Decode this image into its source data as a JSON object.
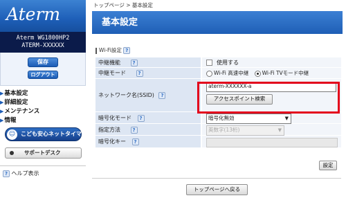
{
  "sidebar": {
    "brand": "Aterm",
    "model_line1": "Aterm WG1800HP2",
    "model_line2": "ATERM-XXXXXX",
    "save_label": "保存",
    "logout_label": "ログアウト",
    "nav": [
      {
        "label": "基本設定"
      },
      {
        "label": "詳細設定"
      },
      {
        "label": "メンテナンス"
      },
      {
        "label": "情報"
      }
    ],
    "kids_timer_label": "こども安心ネットタイマー",
    "support_label": "サポートデスク",
    "help_label": "ヘルプ表示"
  },
  "breadcrumb": "トップページ > 基本設定",
  "page_title": "基本設定",
  "section_label": "Wi-Fi設定",
  "form": {
    "relay_function": {
      "label": "中継機能",
      "checkbox_label": "使用する",
      "checked": false
    },
    "relay_mode": {
      "label": "中継モード",
      "options": [
        {
          "label": "Wi-Fi 高速中継",
          "selected": false
        },
        {
          "label": "Wi-Fi TVモード中継",
          "selected": true
        }
      ]
    },
    "ssid": {
      "label": "ネットワーク名(SSID)",
      "value": "aterm-XXXXXX-a",
      "search_button": "アクセスポイント検索"
    },
    "encryption_mode": {
      "label": "暗号化モード",
      "value": "暗号化無効"
    },
    "method": {
      "label": "指定方法",
      "value": "英数字(13桁)"
    },
    "encryption_key": {
      "label": "暗号化キー",
      "value": ""
    }
  },
  "set_button": "設定",
  "top_page_button": "トップページへ戻る",
  "help_icon": "?",
  "colors": {
    "highlight": "#e3001b",
    "header_blue": "#1f5fb6"
  }
}
